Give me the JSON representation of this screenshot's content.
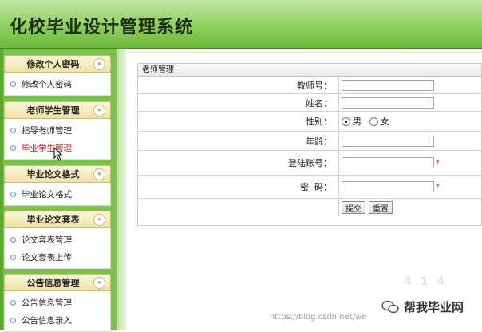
{
  "app_title": "化校毕业设计管理系统",
  "sidebar": {
    "sections": [
      {
        "title": "修改个人密码",
        "items": [
          "修改个人密码"
        ]
      },
      {
        "title": "老师学生管理",
        "items": [
          "指导老师管理",
          "毕业学生管理"
        ]
      },
      {
        "title": "毕业论文格式",
        "items": [
          "毕业论文格式"
        ]
      },
      {
        "title": "毕业论文套表",
        "items": [
          "论文套表管理",
          "论文套表上传"
        ]
      },
      {
        "title": "公告信息管理",
        "items": [
          "公告信息管理",
          "公告信息录入"
        ]
      }
    ],
    "toggle_glyph": "«"
  },
  "panel": {
    "title": "老师管理",
    "fields": {
      "teacher_id": {
        "label": "教师号：",
        "value": ""
      },
      "name": {
        "label": "姓名：",
        "value": ""
      },
      "gender": {
        "label": "性别：",
        "options": [
          "男",
          "女"
        ],
        "selected": "男"
      },
      "age": {
        "label": "年龄：",
        "value": ""
      },
      "login": {
        "label": "登陆账号：",
        "value": "",
        "required_mark": "*"
      },
      "password": {
        "label": "密  码：",
        "value": "",
        "required_mark": "*"
      }
    },
    "buttons": {
      "submit": "提交",
      "reset": "重置"
    }
  },
  "watermark": {
    "url": "https://blog.csdn.net/we",
    "wechat_name": "帮我毕业网",
    "faint": "4 1 4"
  },
  "colors": {
    "header_green": "#8fcf5e",
    "accent_red": "#c21a1a"
  }
}
